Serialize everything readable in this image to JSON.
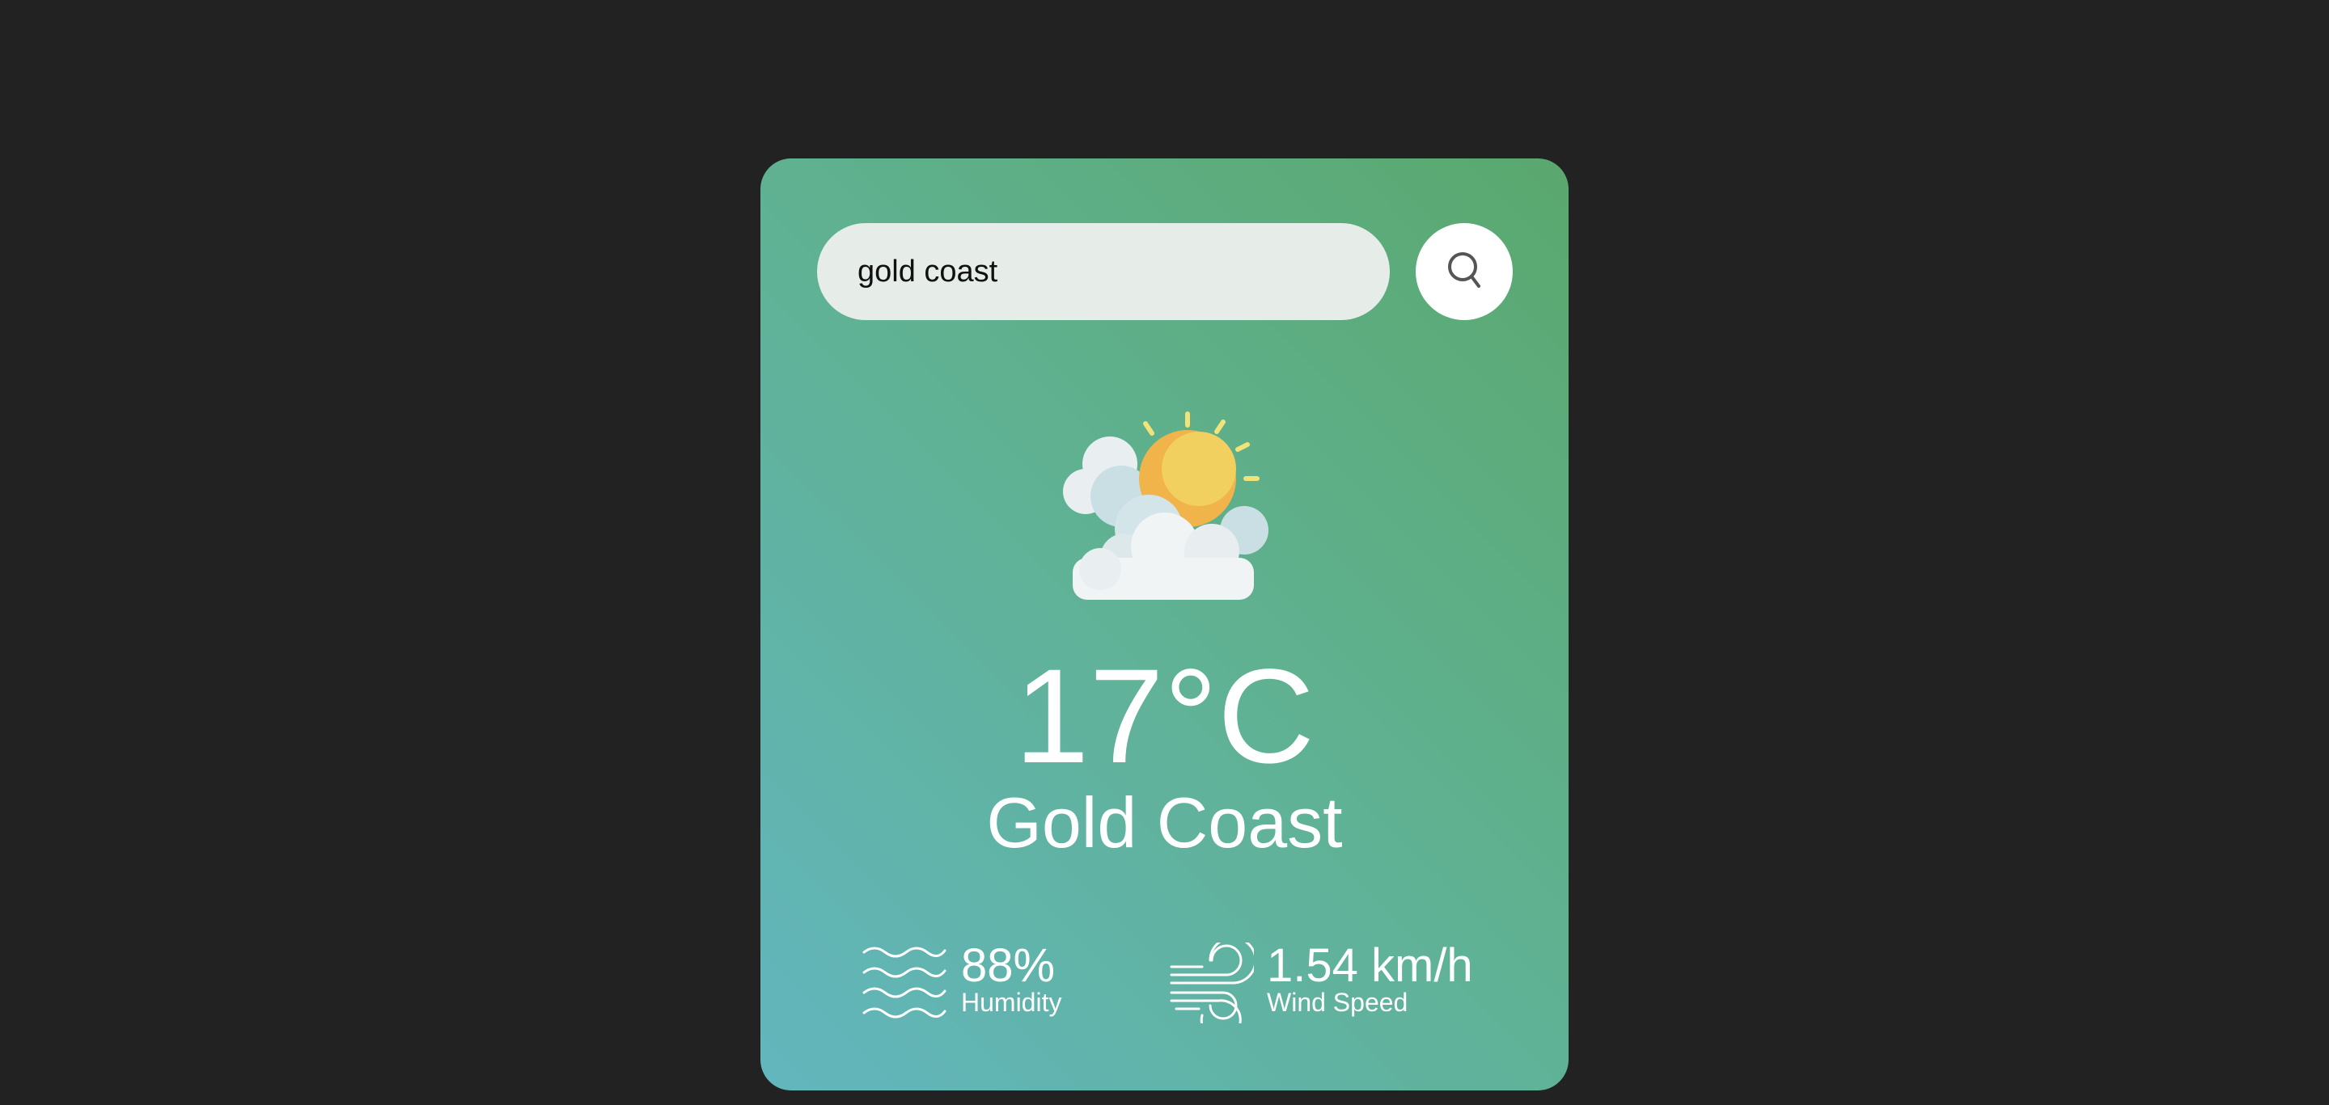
{
  "search": {
    "value": "gold coast",
    "placeholder": ""
  },
  "weather": {
    "icon": "partly-cloudy-sun-icon",
    "temperature": "17°C",
    "city": "Gold Coast"
  },
  "details": {
    "humidity": {
      "icon": "humidity-waves-icon",
      "value": "88%",
      "label": "Humidity"
    },
    "wind": {
      "icon": "wind-icon",
      "value": "1.54 km/h",
      "label": "Wind Speed"
    }
  },
  "colors": {
    "background": "#222222",
    "card_gradient_start": "#5aa86e",
    "card_gradient_end": "#62b6be",
    "text": "#ffffff",
    "sun": "#f0b44a"
  }
}
